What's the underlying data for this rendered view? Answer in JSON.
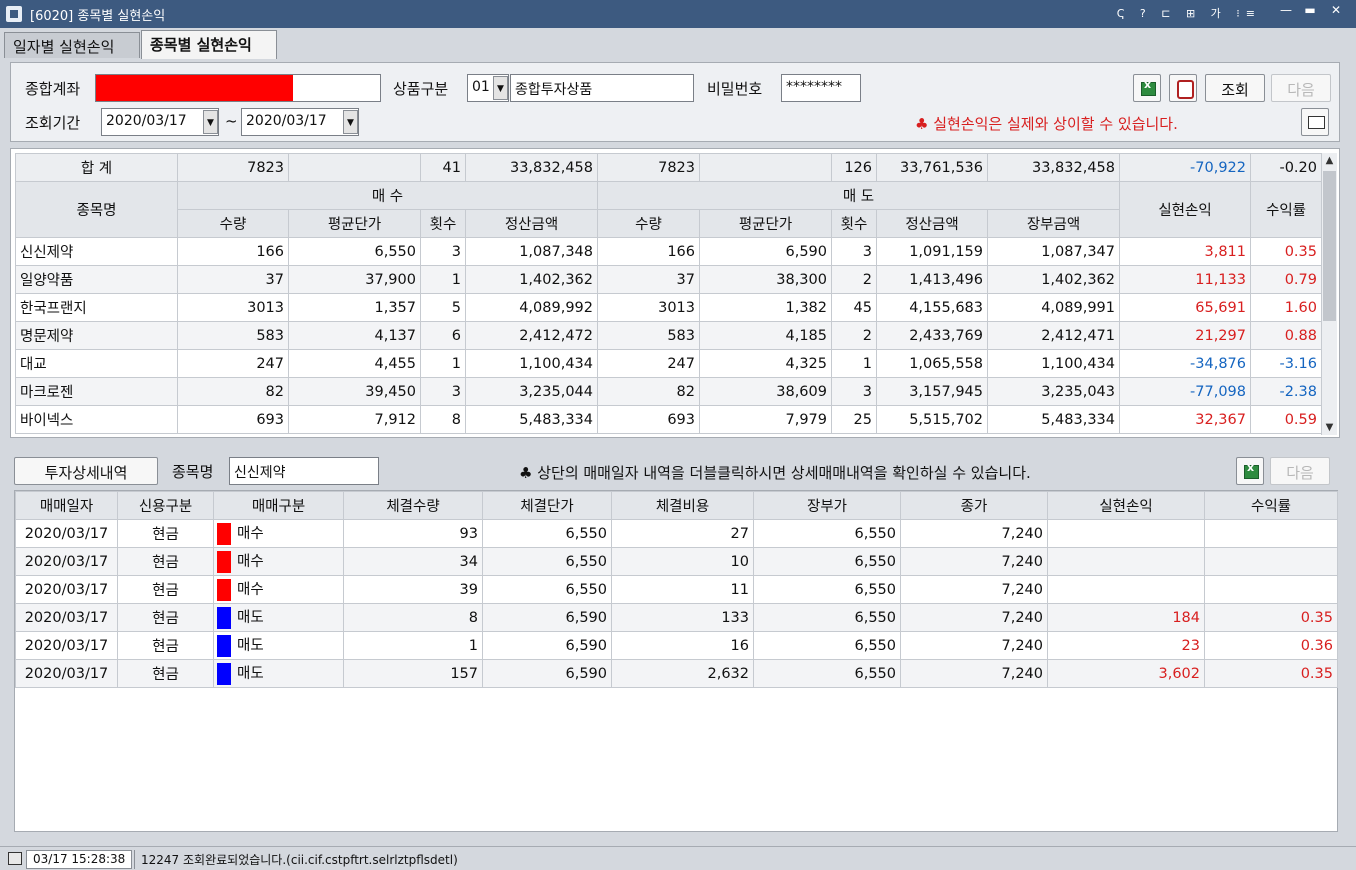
{
  "window": {
    "title": "[6020] 종목별 실현손익",
    "tool_icons": "Ҁ ? ⊏ ⊞ 가 ⁝≡",
    "minimize": "—",
    "maximize": "▬",
    "close": "✕"
  },
  "tabs": [
    {
      "label": "일자별 실현손익",
      "active": false
    },
    {
      "label": "종목별 실현손익",
      "active": true
    }
  ],
  "query": {
    "account_label": "종합계좌",
    "account_value": "",
    "product_label": "상품구분",
    "product_code": "01",
    "product_name": "종합투자상품",
    "password_label": "비밀번호",
    "password_value": "********",
    "period_label": "조회기간",
    "date_from": "2020/03/17",
    "date_sep": "~",
    "date_to": "2020/03/17",
    "search_button": "조회",
    "next_button": "다음",
    "notice": "♣ 실현손익은 실제와 상이할 수 있습니다."
  },
  "summary": {
    "label": "합 계",
    "buy_qty": "7823",
    "buy_avg": "",
    "buy_count": "41",
    "buy_amount": "33,832,458",
    "sell_qty": "7823",
    "sell_avg": "",
    "sell_count": "126",
    "sell_amount": "33,761,536",
    "book_amount": "33,832,458",
    "pnl": "-70,922",
    "rate": "-0.20"
  },
  "upper_headers": {
    "stock": "종목명",
    "buy_group": "매  수",
    "sell_group": "매  도",
    "pnl": "실현손익",
    "rate": "수익률",
    "qty": "수량",
    "avg": "평균단가",
    "count": "횟수",
    "amount": "정산금액",
    "book": "장부금액"
  },
  "upper_rows": [
    {
      "name": "신신제약",
      "bq": "166",
      "ba": "6,550",
      "bc": "3",
      "bm": "1,087,348",
      "sq": "166",
      "sa": "6,590",
      "sc": "3",
      "sm": "1,091,159",
      "book": "1,087,347",
      "pnl": "3,811",
      "rate": "0.35",
      "sign": "red"
    },
    {
      "name": "일양약품",
      "bq": "37",
      "ba": "37,900",
      "bc": "1",
      "bm": "1,402,362",
      "sq": "37",
      "sa": "38,300",
      "sc": "2",
      "sm": "1,413,496",
      "book": "1,402,362",
      "pnl": "11,133",
      "rate": "0.79",
      "sign": "red"
    },
    {
      "name": "한국프랜지",
      "bq": "3013",
      "ba": "1,357",
      "bc": "5",
      "bm": "4,089,992",
      "sq": "3013",
      "sa": "1,382",
      "sc": "45",
      "sm": "4,155,683",
      "book": "4,089,991",
      "pnl": "65,691",
      "rate": "1.60",
      "sign": "red"
    },
    {
      "name": "명문제약",
      "bq": "583",
      "ba": "4,137",
      "bc": "6",
      "bm": "2,412,472",
      "sq": "583",
      "sa": "4,185",
      "sc": "2",
      "sm": "2,433,769",
      "book": "2,412,471",
      "pnl": "21,297",
      "rate": "0.88",
      "sign": "red"
    },
    {
      "name": "대교",
      "bq": "247",
      "ba": "4,455",
      "bc": "1",
      "bm": "1,100,434",
      "sq": "247",
      "sa": "4,325",
      "sc": "1",
      "sm": "1,065,558",
      "book": "1,100,434",
      "pnl": "-34,876",
      "rate": "-3.16",
      "sign": "blue"
    },
    {
      "name": "마크로젠",
      "bq": "82",
      "ba": "39,450",
      "bc": "3",
      "bm": "3,235,044",
      "sq": "82",
      "sa": "38,609",
      "sc": "3",
      "sm": "3,157,945",
      "book": "3,235,043",
      "pnl": "-77,098",
      "rate": "-2.38",
      "sign": "blue"
    },
    {
      "name": "바이넥스",
      "bq": "693",
      "ba": "7,912",
      "bc": "8",
      "bm": "5,483,334",
      "sq": "693",
      "sa": "7,979",
      "sc": "25",
      "sm": "5,515,702",
      "book": "5,483,334",
      "pnl": "32,367",
      "rate": "0.59",
      "sign": "red"
    }
  ],
  "detail": {
    "button": "투자상세내역",
    "stock_label": "종목명",
    "stock_value": "신신제약",
    "notice": "♣ 상단의 매매일자 내역을 더블클릭하시면 상세매매내역을 확인하실 수 있습니다.",
    "next_button": "다음",
    "headers": [
      "매매일자",
      "신용구분",
      "매매구분",
      "체결수량",
      "체결단가",
      "체결비용",
      "장부가",
      "종가",
      "실현손익",
      "수익률"
    ],
    "rows": [
      {
        "date": "2020/03/17",
        "credit": "현금",
        "side": "매수",
        "color": "#ff0000",
        "qty": "93",
        "price": "6,550",
        "cost": "27",
        "book": "6,550",
        "close": "7,240",
        "pnl": "",
        "rate": ""
      },
      {
        "date": "2020/03/17",
        "credit": "현금",
        "side": "매수",
        "color": "#ff0000",
        "qty": "34",
        "price": "6,550",
        "cost": "10",
        "book": "6,550",
        "close": "7,240",
        "pnl": "",
        "rate": ""
      },
      {
        "date": "2020/03/17",
        "credit": "현금",
        "side": "매수",
        "color": "#ff0000",
        "qty": "39",
        "price": "6,550",
        "cost": "11",
        "book": "6,550",
        "close": "7,240",
        "pnl": "",
        "rate": ""
      },
      {
        "date": "2020/03/17",
        "credit": "현금",
        "side": "매도",
        "color": "#0000ff",
        "qty": "8",
        "price": "6,590",
        "cost": "133",
        "book": "6,550",
        "close": "7,240",
        "pnl": "184",
        "rate": "0.35"
      },
      {
        "date": "2020/03/17",
        "credit": "현금",
        "side": "매도",
        "color": "#0000ff",
        "qty": "1",
        "price": "6,590",
        "cost": "16",
        "book": "6,550",
        "close": "7,240",
        "pnl": "23",
        "rate": "0.36"
      },
      {
        "date": "2020/03/17",
        "credit": "현금",
        "side": "매도",
        "color": "#0000ff",
        "qty": "157",
        "price": "6,590",
        "cost": "2,632",
        "book": "6,550",
        "close": "7,240",
        "pnl": "3,602",
        "rate": "0.35"
      }
    ]
  },
  "status": {
    "time": "03/17 15:28:38",
    "message": "12247 조회완료되었습니다.(cii.cif.cstpftrt.selrlztpflsdetl)"
  }
}
